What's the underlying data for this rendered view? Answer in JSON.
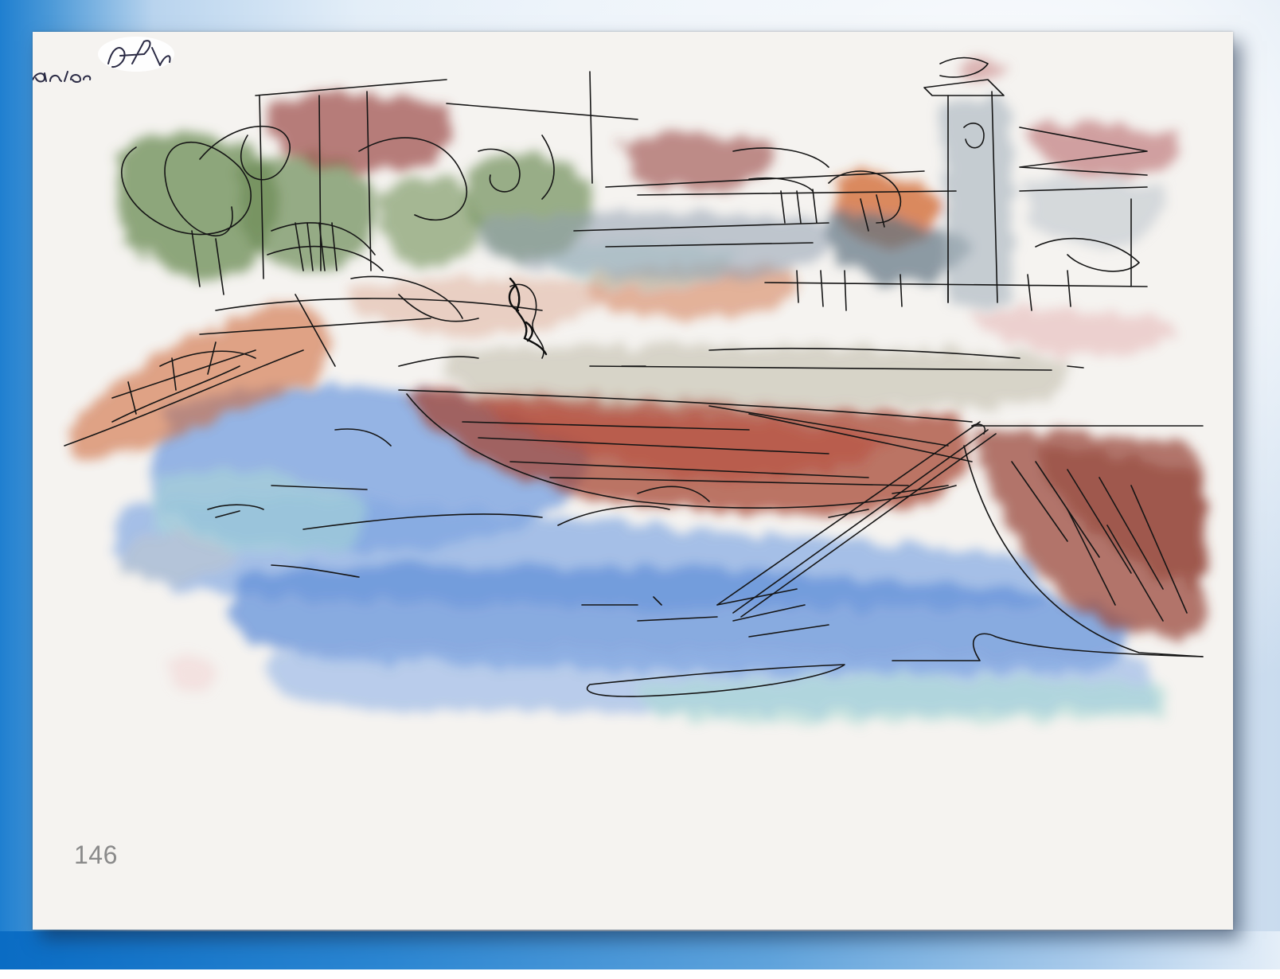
{
  "page": {
    "number": "146"
  },
  "artwork": {
    "palette": {
      "tree_green": "#6f8f5a",
      "roof_red": "#9b4a47",
      "terracotta": "#cf6b3e",
      "water_blue": "#4f86d8",
      "water_teal": "#9fd6cf",
      "boat_red": "#a03a2c",
      "tower_gray": "#9aa9b3",
      "ink": "#151515",
      "paper": "#f5f3f0"
    },
    "signature_lettering": "an lac"
  }
}
